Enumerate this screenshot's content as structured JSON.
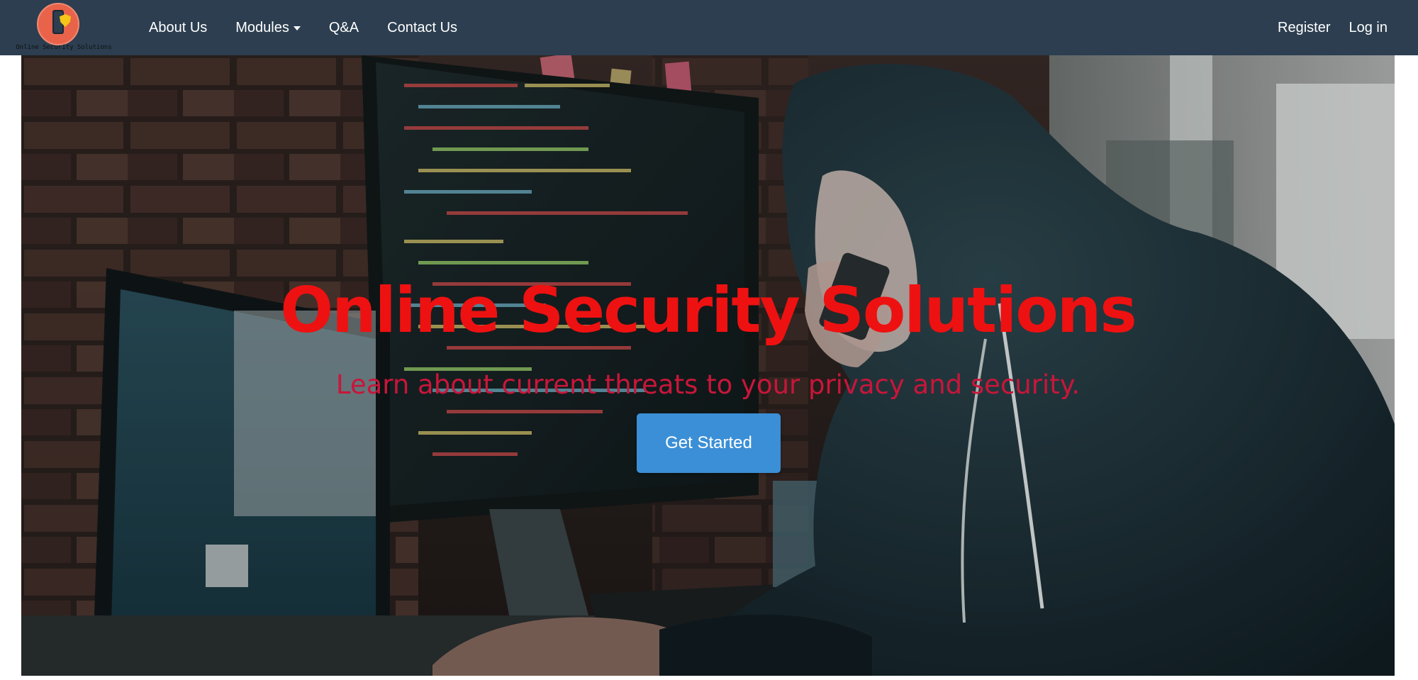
{
  "brand": {
    "name": "Online Security Solutions",
    "logo_icon": "phone-shield-logo-icon"
  },
  "nav": {
    "left": [
      {
        "label": "About Us"
      },
      {
        "label": "Modules",
        "dropdown": true
      },
      {
        "label": "Q&A"
      },
      {
        "label": "Contact Us"
      }
    ],
    "right": [
      {
        "label": "Register"
      },
      {
        "label": "Log in"
      }
    ]
  },
  "hero": {
    "title": "Online Security Solutions",
    "subtitle": "Learn about current threats to your privacy and security.",
    "cta_label": "Get Started",
    "background": "hooded-hacker-at-computer-photo"
  },
  "colors": {
    "navbar": "#2c3e50",
    "title": "#ee1111",
    "subtitle": "#c8163a",
    "button": "#3b8fd6",
    "logo_circle": "#e8634a"
  }
}
